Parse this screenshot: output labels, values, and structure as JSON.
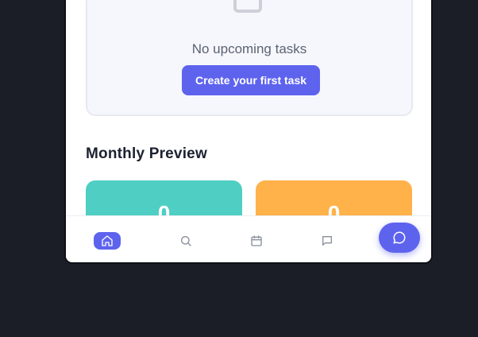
{
  "empty_state": {
    "message": "No upcoming tasks",
    "cta_label": "Create your first task"
  },
  "monthly_preview": {
    "title": "Monthly Preview",
    "cards": [
      {
        "value": "0",
        "color": "#4fcfc3"
      },
      {
        "value": "0",
        "color": "#ffb14a"
      }
    ]
  },
  "bottom_nav": {
    "items": [
      {
        "icon": "home-icon",
        "active": true
      },
      {
        "icon": "search-icon",
        "active": false
      },
      {
        "icon": "calendar-icon",
        "active": false
      },
      {
        "icon": "message-icon",
        "active": false
      }
    ],
    "fab_icon": "chat-icon"
  },
  "colors": {
    "accent": "#5e63ee",
    "background": "#1b1e27"
  }
}
